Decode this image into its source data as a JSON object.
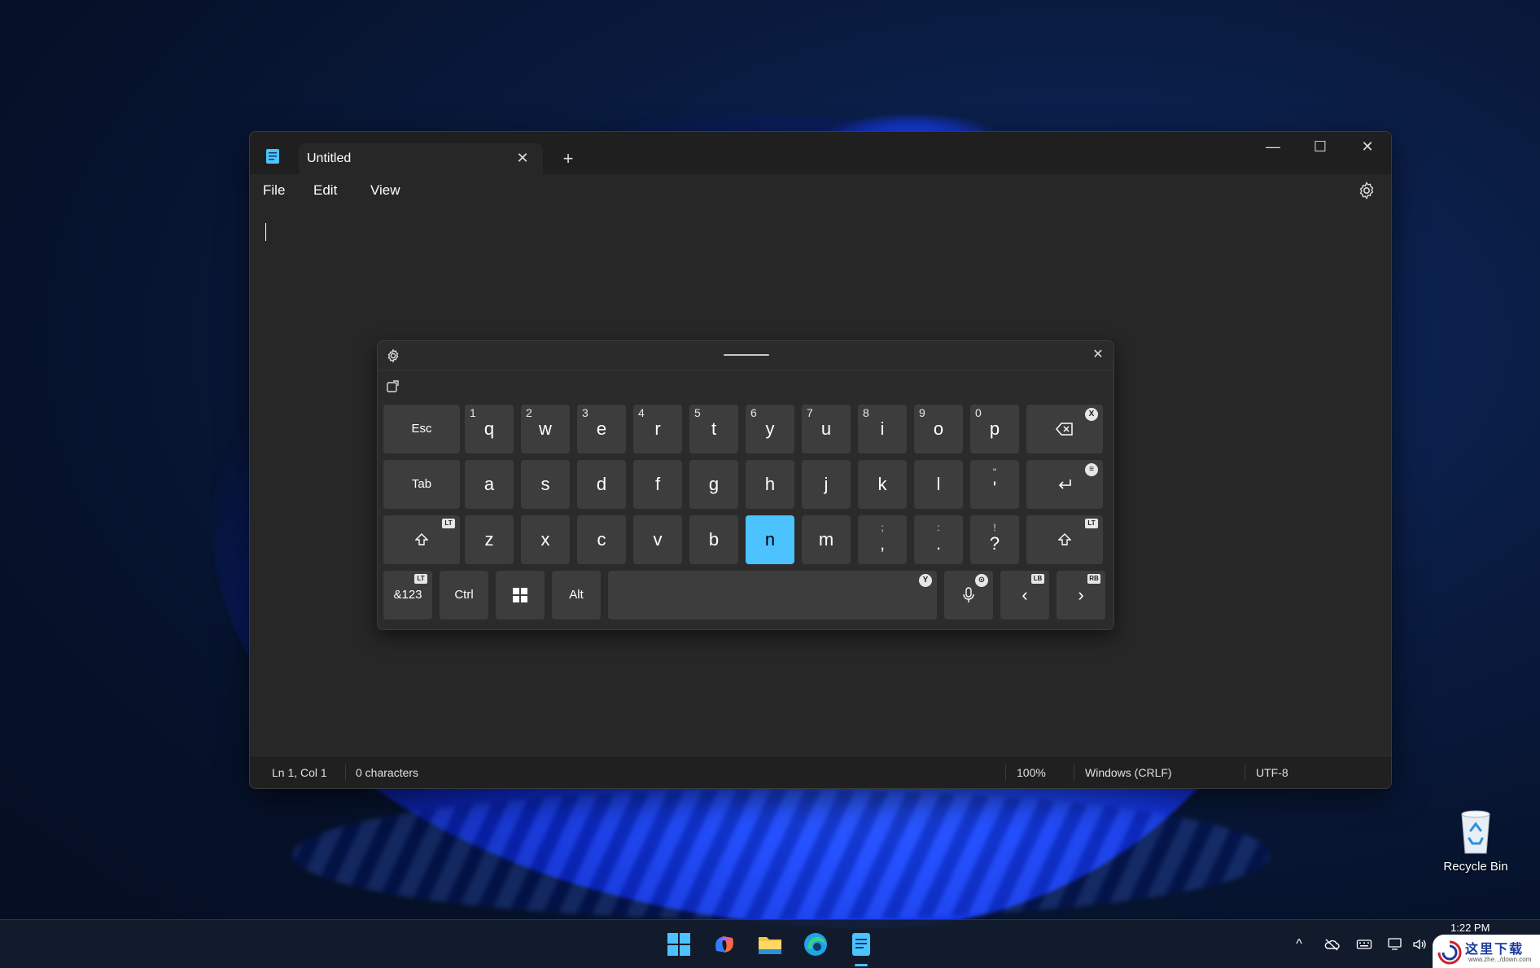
{
  "window": {
    "tab_title": "Untitled",
    "tab_close": "✕",
    "new_tab": "+",
    "minimize": "—",
    "maximize": "☐",
    "close": "✕"
  },
  "menu": {
    "file": "File",
    "edit": "Edit",
    "view": "View"
  },
  "status": {
    "position": "Ln 1, Col 1",
    "characters": "0 characters",
    "zoom": "100%",
    "line_endings": "Windows (CRLF)",
    "encoding": "UTF-8"
  },
  "keyboard": {
    "close": "✕",
    "row1": [
      {
        "label": "Esc"
      },
      {
        "num": "1",
        "label": "q"
      },
      {
        "num": "2",
        "label": "w"
      },
      {
        "num": "3",
        "label": "e"
      },
      {
        "num": "4",
        "label": "r"
      },
      {
        "num": "5",
        "label": "t"
      },
      {
        "num": "6",
        "label": "y"
      },
      {
        "num": "7",
        "label": "u"
      },
      {
        "num": "8",
        "label": "i"
      },
      {
        "num": "9",
        "label": "o"
      },
      {
        "num": "0",
        "label": "p"
      }
    ],
    "row2": [
      {
        "label": "Tab"
      },
      {
        "label": "a"
      },
      {
        "label": "s"
      },
      {
        "label": "d"
      },
      {
        "label": "f"
      },
      {
        "label": "g"
      },
      {
        "label": "h"
      },
      {
        "label": "j"
      },
      {
        "label": "k"
      },
      {
        "label": "l"
      },
      {
        "sup": "\"",
        "label": "'"
      }
    ],
    "row3": [
      {
        "label": "z"
      },
      {
        "label": "x"
      },
      {
        "label": "c"
      },
      {
        "label": "v"
      },
      {
        "label": "b"
      },
      {
        "label": "n",
        "active": true
      },
      {
        "label": "m"
      },
      {
        "sup": ";",
        "label": ","
      },
      {
        "sup": ":",
        "label": "."
      },
      {
        "sup": "!",
        "label": "?"
      }
    ],
    "row4": {
      "symbols": "&123",
      "ctrl": "Ctrl",
      "alt": "Alt",
      "prev": "‹",
      "next": "›"
    },
    "badges": {
      "backspace": "X",
      "enter": "≡",
      "shift": "LT",
      "space": "Y",
      "mic": "⊙",
      "left": "LB",
      "right": "RB",
      "symbols": "LT"
    },
    "accent_color": "#4cc2ff"
  },
  "desktop": {
    "recycle_bin": "Recycle Bin"
  },
  "taskbar": {
    "clock": "1:22 PM",
    "tray_chevron": "^",
    "watermark": "这里下载",
    "watermark_sub": "www.zhe.../down.com"
  }
}
